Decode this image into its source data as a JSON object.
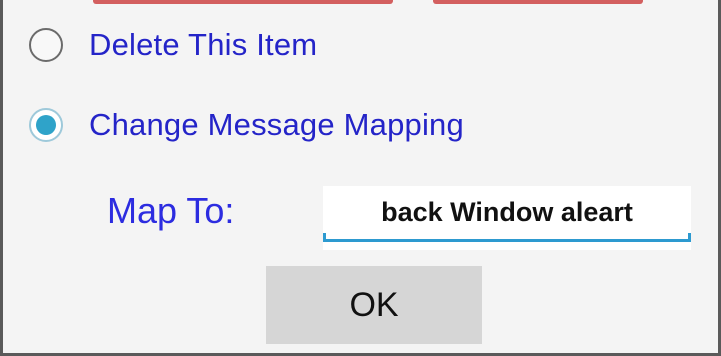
{
  "dialog": {
    "options": [
      {
        "label": "Delete This Item",
        "checked": false
      },
      {
        "label": "Change Message Mapping",
        "checked": true
      }
    ],
    "map_to": {
      "label": "Map To:",
      "value": "back Window aleart"
    },
    "ok_label": "OK"
  },
  "colors": {
    "option_text": "#2424c8",
    "map_label_text": "#2c2ce0",
    "radio_accent": "#2fa3c9",
    "field_underline": "#2d9ad0",
    "button_bg": "#d6d6d6"
  }
}
